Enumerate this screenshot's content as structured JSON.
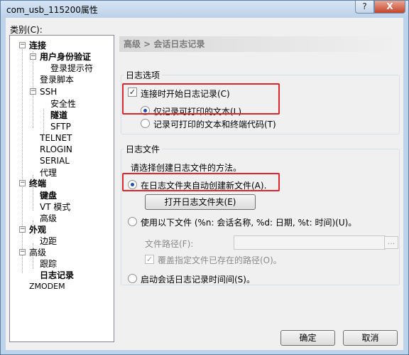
{
  "window": {
    "title": "com_usb_115200属性",
    "help": "?",
    "close": "X"
  },
  "category_label": "类别(C):",
  "tree": {
    "connection": "连接",
    "user_auth": "用户身份验证",
    "login_prompt": "登录提示符",
    "login_script": "登录脚本",
    "ssh": "SSH",
    "security": "安全性",
    "tunnel": "隧道",
    "sftp": "SFTP",
    "telnet": "TELNET",
    "rlogin": "RLOGIN",
    "serial": "SERIAL",
    "proxy": "代理",
    "terminal": "终端",
    "keyboard": "键盘",
    "vt_mode": "VT 模式",
    "advanced_term": "高级",
    "appearance": "外观",
    "margin": "边距",
    "advanced": "高级",
    "trace": "跟踪",
    "logging": "日志记录",
    "zmodem": "ZMODEM"
  },
  "header": "高级 > 会话日志记录",
  "log_options": {
    "title": "日志选项",
    "start_on_connect": "连接时开始日志记录(C)",
    "printable_only": "仅记录可打印的文本(L)",
    "printable_and_codes": "记录可打印的文本和终端代码(T)"
  },
  "log_file": {
    "title": "日志文件",
    "instruction": "请选择创建日志文件的方法。",
    "auto_create": "在日志文件夹自动创建新文件(A).",
    "open_folder": "打开日志文件夹(E)",
    "use_following": "使用以下文件 (%n: 会话名称, %d: 日期, %t: 时间)(U)。",
    "file_path_label": "文件路径(F):",
    "browse": "...",
    "overwrite": "覆盖指定文件已存在的路径(O)。",
    "timestamp": "启动会话日志记录时间间(S)。"
  },
  "buttons": {
    "ok": "确定",
    "cancel": "取消"
  },
  "colors": {
    "highlight": "#e0262d",
    "header_text": "#7a7a7a"
  }
}
